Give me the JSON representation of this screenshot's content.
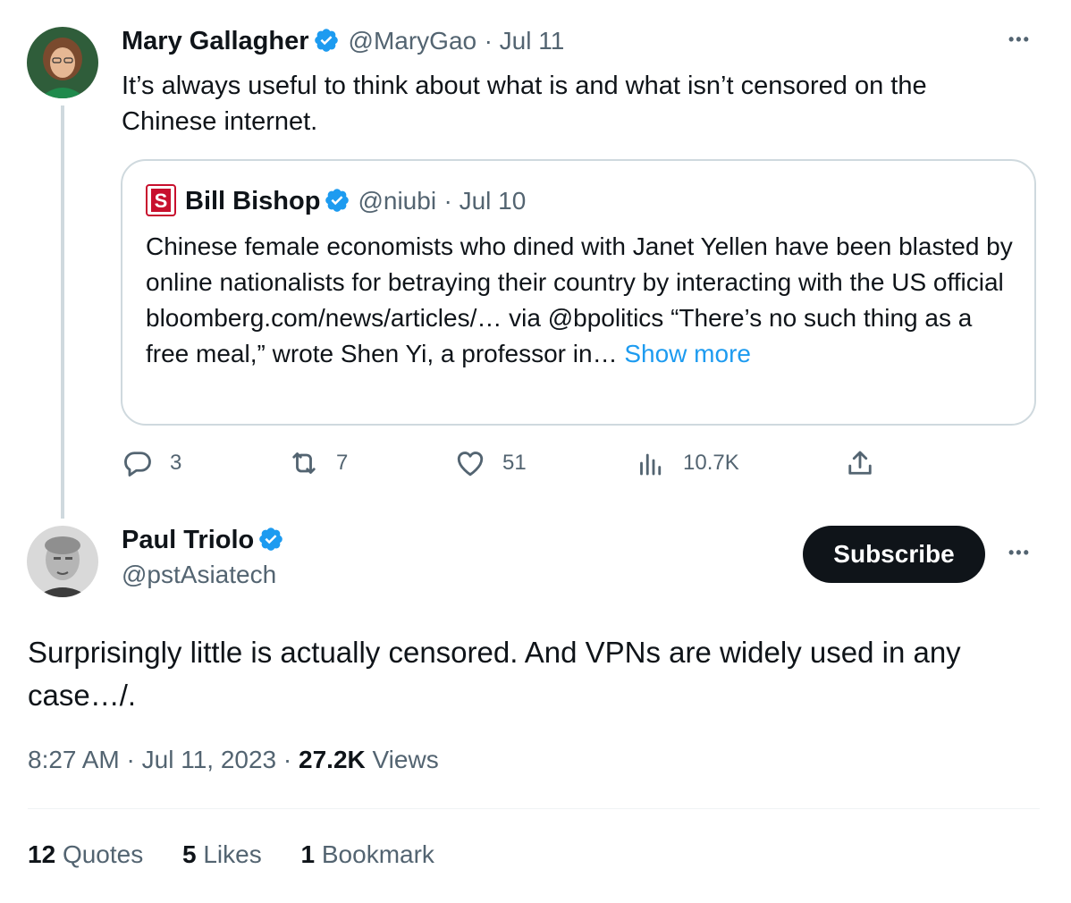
{
  "parent_tweet": {
    "author_name": "Mary Gallagher",
    "handle": "@MaryGao",
    "date": "· Jul 11",
    "text": "It’s always useful to think about what is and what isn’t censored on the Chinese internet.",
    "more_icon": "•••",
    "quoted": {
      "author_name": "Bill Bishop",
      "handle": "@niubi",
      "date": "· Jul 10",
      "text": "Chinese female economists who dined with Janet Yellen have been blasted by online nationalists for betraying their country by interacting with the US official bloomberg.com/news/articles/… via @bpolitics “There’s no such thing as a free meal,” wrote Shen Yi, a professor in…",
      "show_more": "Show more"
    },
    "actions": {
      "replies": "3",
      "retweets": "7",
      "likes": "51",
      "views": "10.7K"
    }
  },
  "main_tweet": {
    "author_name": "Paul Triolo",
    "handle": "@pstAsiatech",
    "subscribe_label": "Subscribe",
    "more_icon": "•••",
    "text": "Surprisingly little is actually censored. And VPNs are widely used in any case…/.",
    "time": "8:27 AM",
    "date": "Jul 11, 2023",
    "views_count": "27.2K",
    "views_label": "Views",
    "stats": [
      {
        "count": "12",
        "label": "Quotes"
      },
      {
        "count": "5",
        "label": "Likes"
      },
      {
        "count": "1",
        "label": "Bookmark"
      }
    ]
  },
  "colors": {
    "accent": "#1d9bf0",
    "secondary_text": "#536471",
    "primary_text": "#0f1419",
    "border": "#cfd9de"
  }
}
